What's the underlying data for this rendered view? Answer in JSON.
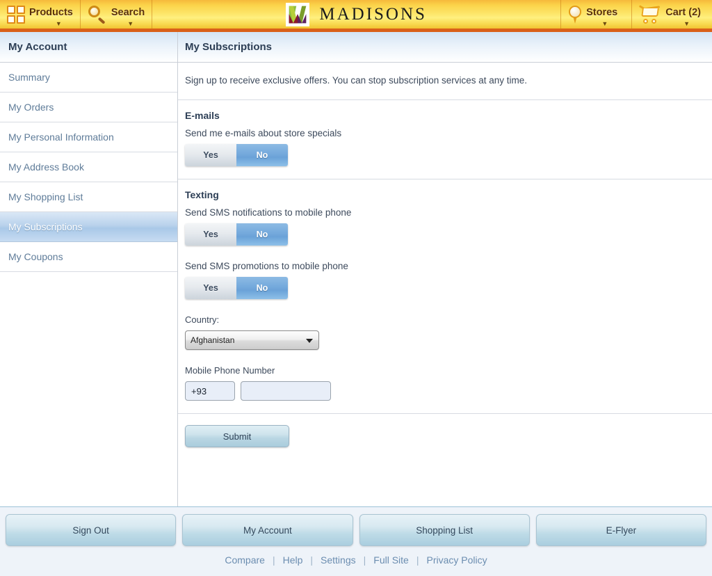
{
  "header": {
    "products": {
      "label": "Products",
      "icon": "grid-icon",
      "caret": "▼"
    },
    "search": {
      "label": "Search",
      "icon": "magnifier-icon",
      "caret": "▼"
    },
    "brand": {
      "name": "MADISONS",
      "logo": "madisons-logo"
    },
    "stores": {
      "label": "Stores",
      "icon": "map-pin-icon",
      "caret": "▼"
    },
    "cart": {
      "label": "Cart (2)",
      "icon": "shopping-cart-icon",
      "caret": "▼"
    },
    "accent_orange": "#d9601a",
    "accent_yellow": "#fde66a"
  },
  "sidebar": {
    "title": "My Account",
    "items": [
      {
        "label": "Summary",
        "active": false
      },
      {
        "label": "My Orders",
        "active": false
      },
      {
        "label": "My Personal Information",
        "active": false
      },
      {
        "label": "My Address Book",
        "active": false
      },
      {
        "label": "My Shopping List",
        "active": false
      },
      {
        "label": "My Subscriptions",
        "active": true
      },
      {
        "label": "My Coupons",
        "active": false
      }
    ]
  },
  "main": {
    "title": "My Subscriptions",
    "intro": "Sign up to receive exclusive offers. You can stop subscription services at any time.",
    "emails": {
      "heading": "E-mails",
      "label": "Send me e-mails about store specials",
      "toggle": {
        "yes": "Yes",
        "no": "No",
        "selected": "No"
      }
    },
    "texting": {
      "heading": "Texting",
      "notifications": {
        "label": "Send SMS notifications to mobile phone",
        "toggle": {
          "yes": "Yes",
          "no": "No",
          "selected": "No"
        }
      },
      "promotions": {
        "label": "Send SMS promotions to mobile phone",
        "toggle": {
          "yes": "Yes",
          "no": "No",
          "selected": "No"
        }
      },
      "country": {
        "label": "Country:",
        "selected": "Afghanistan",
        "caret": "▼"
      },
      "phone": {
        "label": "Mobile Phone Number",
        "country_code": "+93",
        "number": "",
        "number_placeholder": ""
      }
    },
    "submit_label": "Submit"
  },
  "footer": {
    "buttons": [
      {
        "label": "Sign Out"
      },
      {
        "label": "My Account"
      },
      {
        "label": "Shopping List"
      },
      {
        "label": "E-Flyer"
      }
    ],
    "links": [
      {
        "label": "Compare"
      },
      {
        "label": "Help"
      },
      {
        "label": "Settings"
      },
      {
        "label": "Full Site"
      },
      {
        "label": "Privacy Policy"
      }
    ],
    "link_separator": "|"
  }
}
